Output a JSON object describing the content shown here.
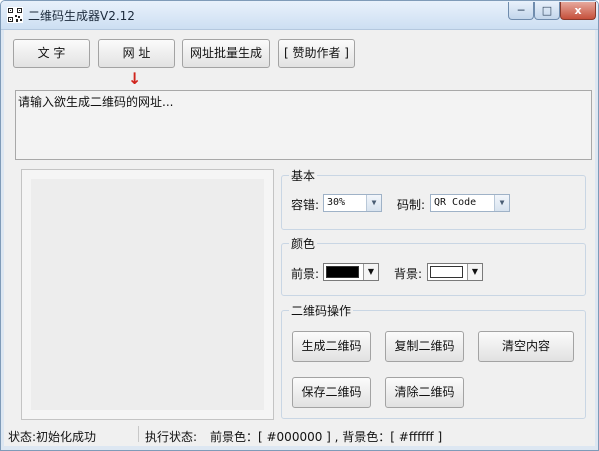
{
  "window": {
    "title": "二维码生成器V2.12",
    "minimize_glyph": "─",
    "maximize_glyph": "□",
    "close_glyph": "x"
  },
  "toolbar": {
    "text_label": "文 字",
    "url_label": "网 址",
    "batch_url_label": "网址批量生成",
    "sponsor_label": "[ 赞助作者 ]",
    "arrow_glyph": "↓"
  },
  "input": {
    "value": "请输入欲生成二维码的网址..."
  },
  "basic": {
    "title": "基本",
    "error_label": "容错:",
    "error_value": "30%",
    "code_label": "码制:",
    "code_value": "QR Code"
  },
  "color": {
    "title": "颜色",
    "fg_label": "前景:",
    "bg_label": "背景:",
    "fg_color": "#000000",
    "bg_color": "#ffffff"
  },
  "operations": {
    "title": "二维码操作",
    "generate": "生成二维码",
    "copy": "复制二维码",
    "clear_content": "清空内容",
    "save": "保存二维码",
    "clear_code": "清除二维码"
  },
  "status": {
    "state": "状态:初始化成功",
    "exec_label": "执行状态:",
    "colors": "前景色：[ #000000 ] , 背景色：[ #ffffff ]"
  },
  "icons": {
    "app": "qr-code-icon",
    "dropdown": "▼"
  }
}
